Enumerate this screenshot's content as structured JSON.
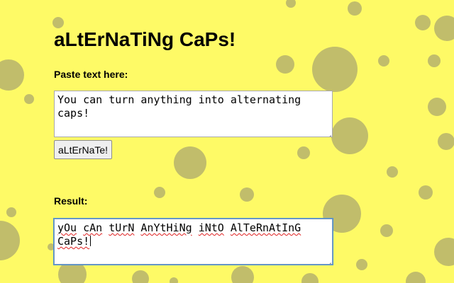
{
  "colors": {
    "background": "#fefa66",
    "spot": "#c1bd6b"
  },
  "page": {
    "title": "aLtErNaTiNg CaPs!"
  },
  "input": {
    "label": "Paste text here:",
    "value": "You can turn anything into alternating caps!"
  },
  "convert_button": {
    "label": "aLtErNaTe!"
  },
  "result": {
    "label": "Result:",
    "words": [
      "yOu",
      "cAn",
      "tUrN",
      "AnYtHiNg",
      "iNtO",
      "AlTeRnAtInG",
      "CaPs!"
    ]
  }
}
